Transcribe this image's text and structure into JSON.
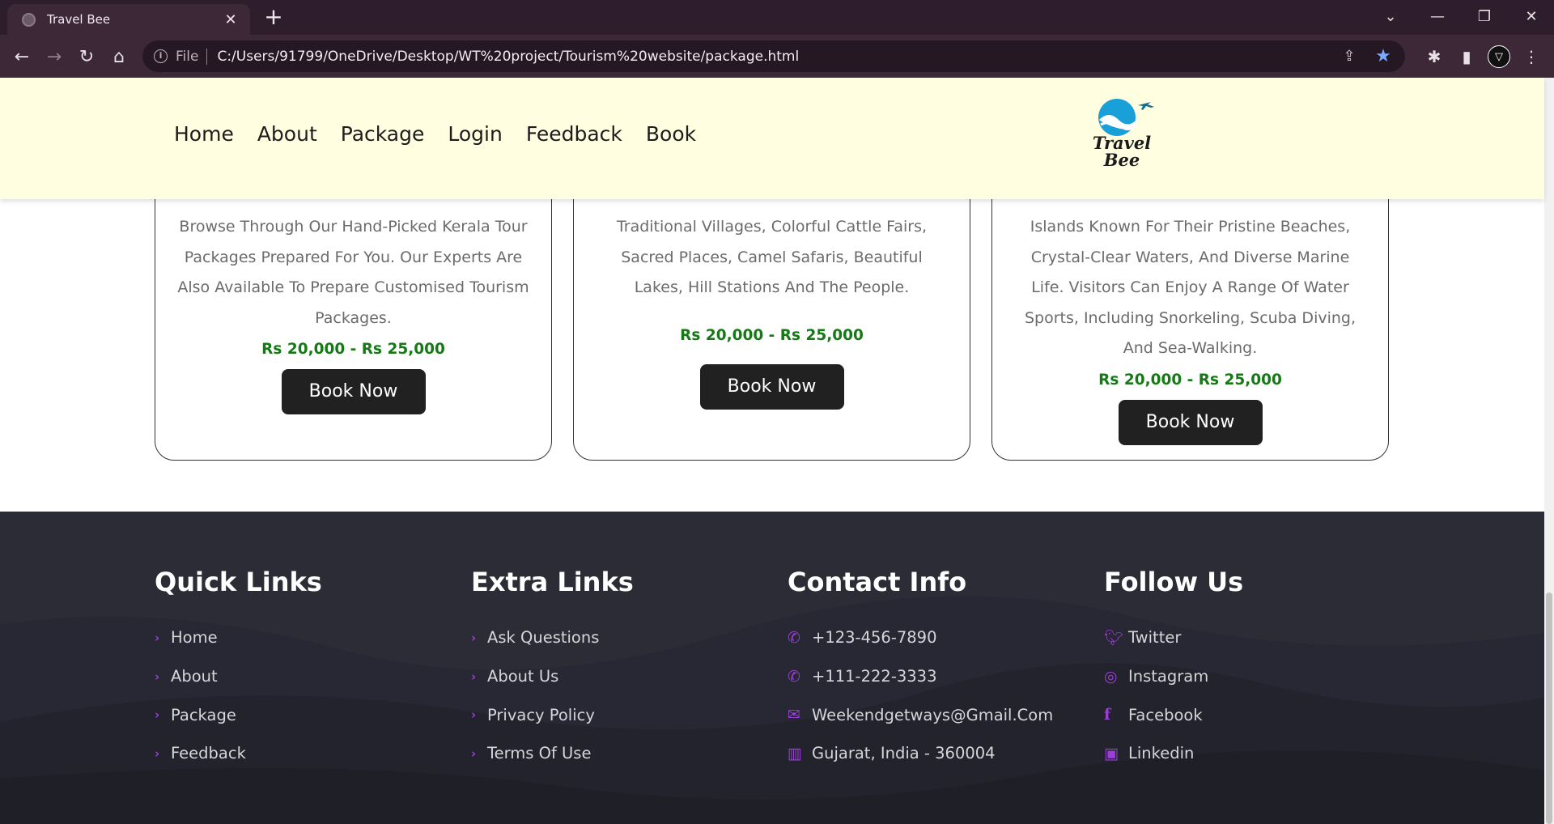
{
  "browser": {
    "tab_title": "Travel Bee",
    "new_tab": "+",
    "file_label": "File",
    "url": "C:/Users/91799/OneDrive/Desktop/WT%20project/Tourism%20website/package.html"
  },
  "nav": {
    "items": [
      "Home",
      "About",
      "Package",
      "Login",
      "Feedback",
      "Book"
    ]
  },
  "logo": {
    "line1": "Travel",
    "line2": "Bee"
  },
  "cards": [
    {
      "description": "Browse Through Our Hand-Picked Kerala Tour Packages Prepared For You. Our Experts Are Also Available To Prepare Customised Tourism Packages.",
      "price": "Rs 20,000 - Rs 25,000",
      "button": "Book Now"
    },
    {
      "description": "Traditional Villages, Colorful Cattle Fairs, Sacred Places, Camel Safaris, Beautiful Lakes, Hill Stations And The People.",
      "price": "Rs 20,000 - Rs 25,000",
      "button": "Book Now"
    },
    {
      "description": "Islands Known For Their Pristine Beaches, Crystal-Clear Waters, And Diverse Marine Life. Visitors Can Enjoy A Range Of Water Sports, Including Snorkeling, Scuba Diving, And Sea-Walking.",
      "price": "Rs 20,000 - Rs 25,000",
      "button": "Book Now"
    }
  ],
  "footer": {
    "quick_links": {
      "title": "Quick Links",
      "items": [
        "Home",
        "About",
        "Package",
        "Feedback"
      ]
    },
    "extra_links": {
      "title": "Extra Links",
      "items": [
        "Ask Questions",
        "About Us",
        "Privacy Policy",
        "Terms Of Use"
      ]
    },
    "contact": {
      "title": "Contact Info",
      "items": [
        {
          "icon": "phone-icon",
          "text": "+123-456-7890"
        },
        {
          "icon": "phone-icon",
          "text": "+111-222-3333"
        },
        {
          "icon": "envelope-icon",
          "text": "Weekendgetways@Gmail.Com"
        },
        {
          "icon": "map-icon",
          "text": "Gujarat, India - 360004"
        }
      ]
    },
    "follow": {
      "title": "Follow Us",
      "items": [
        {
          "icon": "twitter-icon",
          "text": "Twitter"
        },
        {
          "icon": "instagram-icon",
          "text": "Instagram"
        },
        {
          "icon": "facebook-icon",
          "text": "Facebook"
        },
        {
          "icon": "linkedin-icon",
          "text": "Linkedin"
        }
      ]
    }
  },
  "colors": {
    "header_bg": "#fffee0",
    "accent_purple": "#9b3fd8",
    "price_green": "#157a15",
    "button_dark": "#212121",
    "footer_bg": "#2b2c36"
  }
}
